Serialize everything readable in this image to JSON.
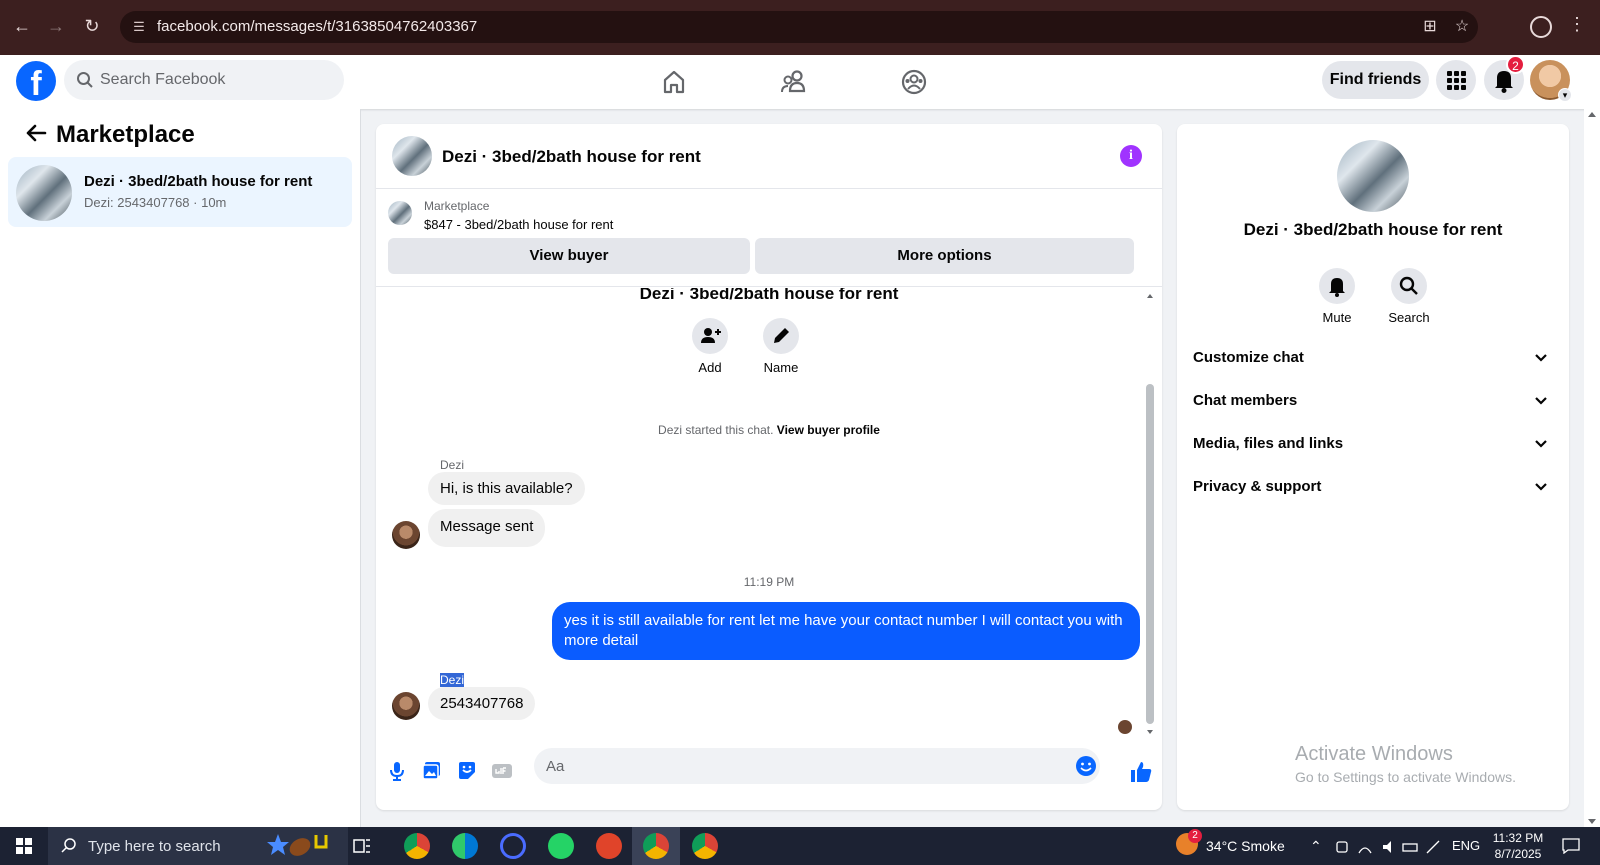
{
  "browser": {
    "url": "facebook.com/messages/t/31638504762403367"
  },
  "fb_nav": {
    "logo_letter": "f",
    "search_placeholder": "Search Facebook",
    "find_friends_label": "Find friends",
    "notification_count": "2"
  },
  "sidebar": {
    "title": "Marketplace",
    "conversations": [
      {
        "title": "Dezi · 3bed/2bath house for rent",
        "subtitle": "Dezi: 2543407768 · 10m"
      }
    ]
  },
  "chat": {
    "header_title": "Dezi · 3bed/2bath house for rent",
    "info_icon_glyph": "i",
    "marketplace_label": "Marketplace",
    "listing_line": "$847 - 3bed/2bath house for rent",
    "view_buyer_label": "View buyer",
    "more_options_label": "More options",
    "thread_title": "Dezi · 3bed/2bath house for rent",
    "add_label": "Add",
    "name_label": "Name",
    "system_text": "Dezi started this chat.",
    "system_link": "View buyer profile",
    "messages": [
      {
        "sender": "Dezi",
        "text": "Hi, is this available?"
      },
      {
        "text": "Message sent"
      },
      {
        "timestamp": "11:19 PM"
      },
      {
        "text": "yes it is still available for rent let me have your contact number I will contact you with more detail"
      },
      {
        "sender": "Dezi",
        "text": "2543407768"
      }
    ],
    "composer_placeholder": "Aa"
  },
  "details": {
    "title": "Dezi · 3bed/2bath house for rent",
    "mute_label": "Mute",
    "search_label": "Search",
    "sections": [
      "Customize chat",
      "Chat members",
      "Media, files and links",
      "Privacy & support"
    ]
  },
  "watermark": {
    "line1": "Activate Windows",
    "line2": "Go to Settings to activate Windows."
  },
  "taskbar": {
    "search_text": "Type here to search",
    "weather_badge": "2",
    "weather": "34°C  Smoke",
    "language": "ENG",
    "time": "11:32 PM",
    "date": "8/7/2025"
  },
  "colors": {
    "facebook_blue": "#0866ff",
    "outgoing_bubble": "#0a5cff",
    "info_purple": "#a033ff",
    "browser_chrome": "#3c1f1f",
    "notification_red": "#e41e3f"
  }
}
